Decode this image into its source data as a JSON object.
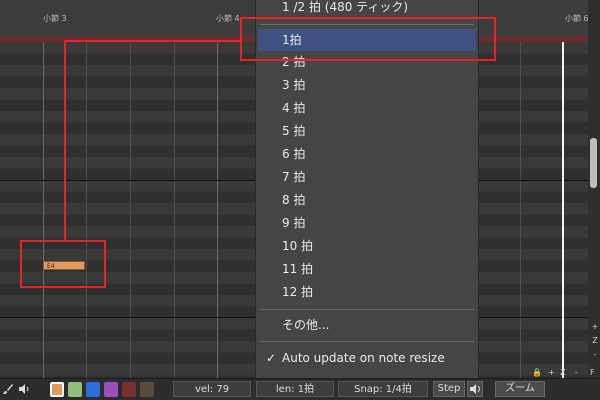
{
  "ruler": {
    "bar3_label": "小節 3",
    "bar4_label": "小節 4",
    "bar6_label": "小節 6"
  },
  "note": {
    "label": "E4",
    "color": "#e0995e"
  },
  "snap_menu": {
    "top_item": "1 /2 拍 (480 ティック)",
    "items": [
      "1拍",
      "2 拍",
      "3 拍",
      "4 拍",
      "5 拍",
      "6 拍",
      "7 拍",
      "8 拍",
      "9 拍",
      "10 拍",
      "11 拍",
      "12 拍"
    ],
    "selected": "1拍",
    "other_label": "その他...",
    "auto_update_label": "Auto update on note resize",
    "auto_update_checked": true,
    "check_glyph": "✓"
  },
  "zoom_panel": {
    "plus": "+",
    "z": "Z",
    "minus": "-",
    "lock": "🔒",
    "h_plus": "+",
    "h_z": "Z",
    "h_minus": "-",
    "f": "F"
  },
  "toolbar": {
    "brush_icon": "brush-icon",
    "speaker_icon": "speaker-icon",
    "swatches": [
      "#e0995e",
      "#8fbf7a",
      "#2d6fd6",
      "#9b4fb8",
      "#7a2f2f",
      "#5a4a3a"
    ],
    "velocity": "vel: 79",
    "length": "len: 1拍",
    "snap": "Snap:  1/4拍",
    "step_label": "Step",
    "zoom_label": "ズーム"
  },
  "colors": {
    "callout": "#e0262b",
    "selection": "#3d5282",
    "playhead": "#f4f4f4",
    "loop_region": "#6b2c2c"
  }
}
